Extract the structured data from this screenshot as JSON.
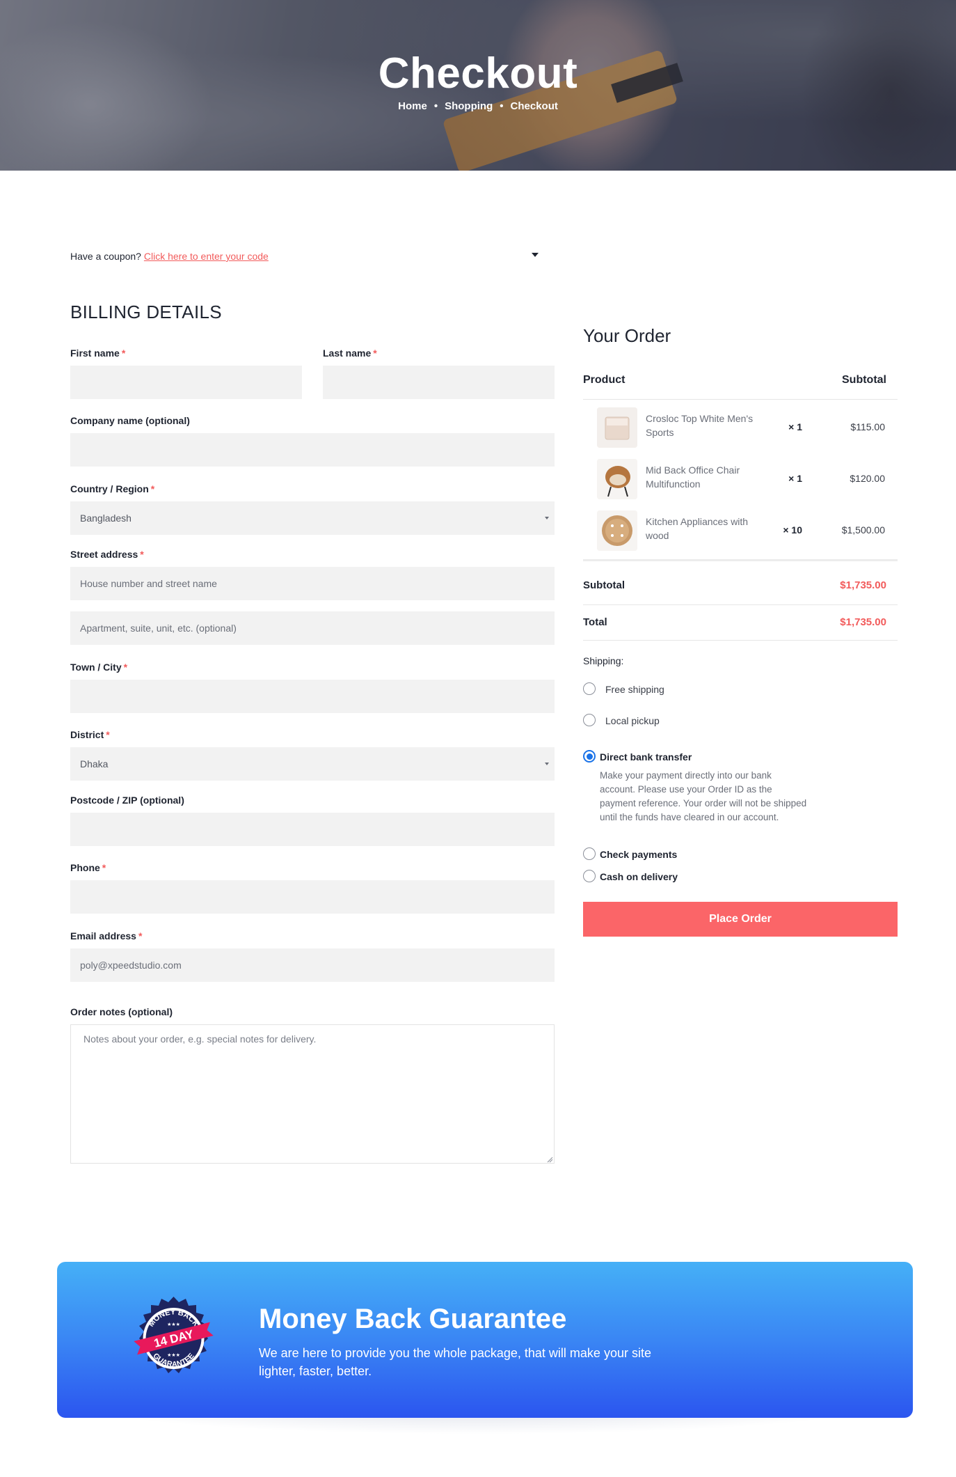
{
  "hero": {
    "title": "Checkout",
    "breadcrumb": [
      "Home",
      "Shopping",
      "Checkout"
    ],
    "separator": "•"
  },
  "coupon": {
    "text": "Have a coupon?",
    "link": "Click here to enter your code"
  },
  "billing": {
    "title": "BILLING DETAILS",
    "first_name_label": "First name",
    "last_name_label": "Last name",
    "company_label": "Company name (optional)",
    "country_label": "Country / Region",
    "country_value": "Bangladesh",
    "street_label": "Street address",
    "street_placeholder": "House number and street name",
    "apartment_placeholder": "Apartment, suite, unit, etc. (optional)",
    "town_label": "Town / City",
    "district_label": "District",
    "district_value": "Dhaka",
    "postcode_label": "Postcode / ZIP (optional)",
    "phone_label": "Phone",
    "email_label": "Email address",
    "email_value": "poly@xpeedstudio.com",
    "notes_label": "Order notes (optional)",
    "notes_placeholder": "Notes about your order, e.g. special notes for delivery.",
    "required_mark": "*"
  },
  "order": {
    "title": "Your Order",
    "col_product": "Product",
    "col_subtotal": "Subtotal",
    "items": [
      {
        "name": "Crosloc Top White Men's Sports",
        "qty": "× 1",
        "price": "$115.00",
        "icon": "white-box-thumb"
      },
      {
        "name": "Mid Back Office Chair Multifunction",
        "qty": "× 1",
        "price": "$120.00",
        "icon": "chair-thumb"
      },
      {
        "name": "Kitchen Appliances with wood",
        "qty": "× 10",
        "price": "$1,500.00",
        "icon": "wooden-board-thumb"
      }
    ],
    "subtotal_label": "Subtotal",
    "subtotal_value": "$1,735.00",
    "total_label": "Total",
    "total_value": "$1,735.00",
    "shipping_label": "Shipping:",
    "shipping_options": [
      "Free shipping",
      "Local pickup"
    ],
    "payment_options": [
      "Direct bank transfer",
      "Check payments",
      "Cash on delivery"
    ],
    "selected_payment": "Direct bank transfer",
    "payment_description": "Make your payment directly into our bank account. Please use your Order ID as the payment reference. Your order will not be shipped until the funds have cleared in our account.",
    "place_order": "Place Order"
  },
  "banner": {
    "title": "Money Back Guarantee",
    "text": "We are here to provide you the whole package, that will make your site lighter, faster, better.",
    "badge_top": "MONEY BACK",
    "badge_mid": "14 DAY",
    "badge_bottom": "GUARANTEE"
  },
  "colors": {
    "accent": "#f25b5b",
    "button": "#fb6568",
    "radio_selected": "#1a73e8",
    "banner_top": "#45b0f7",
    "banner_bottom": "#2b55ef"
  }
}
